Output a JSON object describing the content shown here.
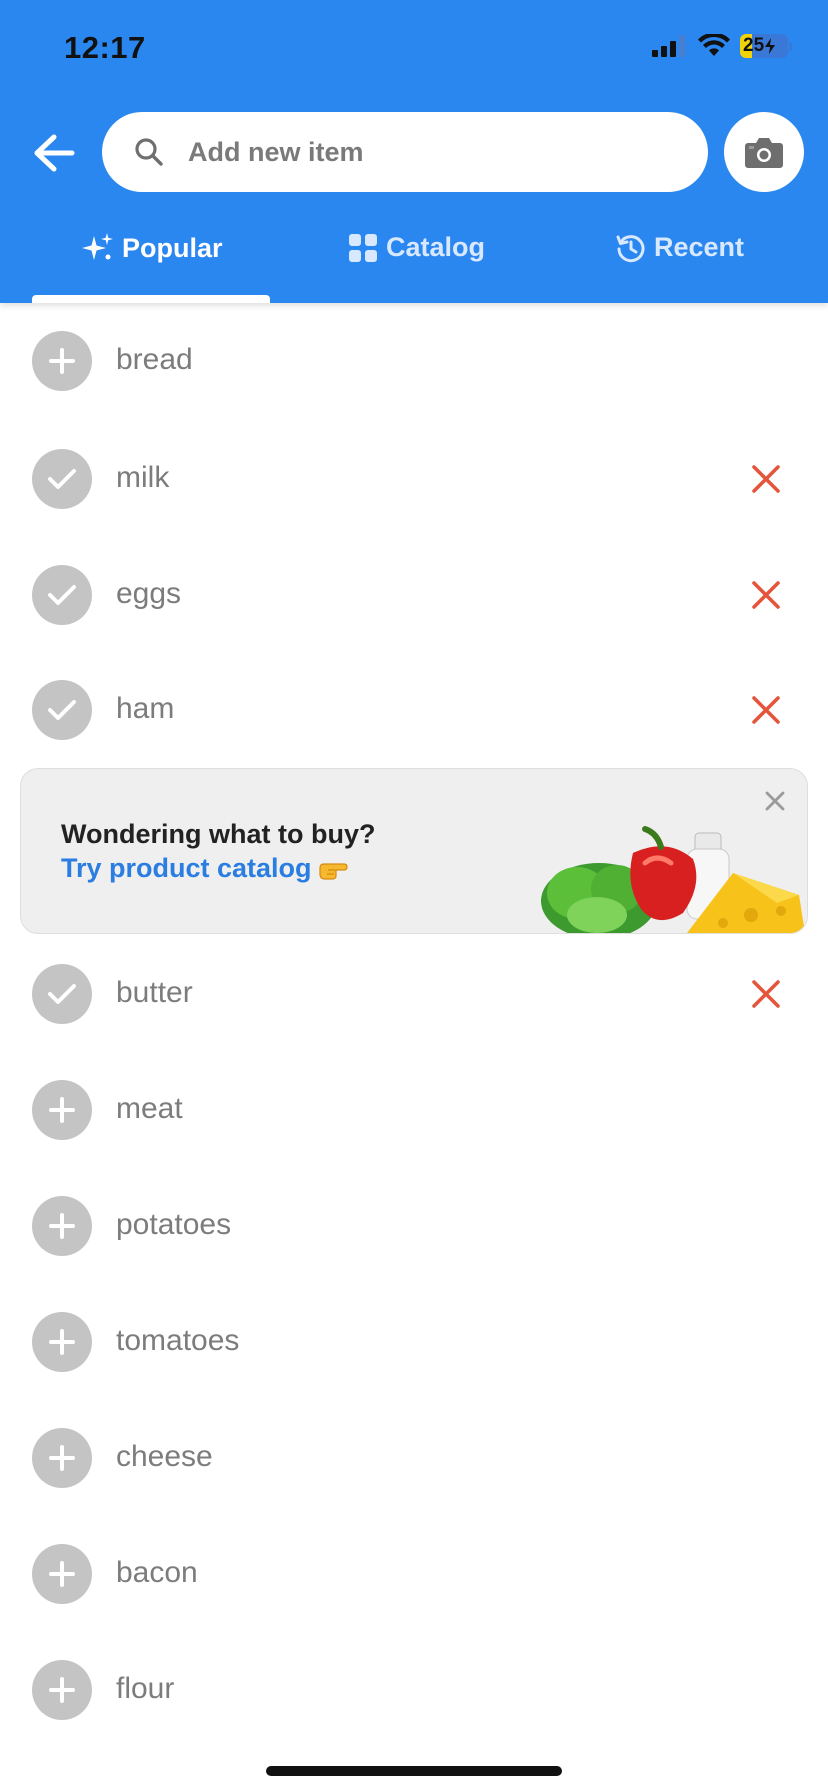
{
  "status_bar": {
    "time": "12:17",
    "battery": "25"
  },
  "search": {
    "placeholder": "Add new item"
  },
  "tabs": [
    {
      "label": "Popular",
      "active": true
    },
    {
      "label": "Catalog",
      "active": false
    },
    {
      "label": "Recent",
      "active": false
    }
  ],
  "items_top": [
    {
      "label": "bread",
      "state": "add"
    },
    {
      "label": "milk",
      "state": "added"
    },
    {
      "label": "eggs",
      "state": "added"
    },
    {
      "label": "ham",
      "state": "added"
    }
  ],
  "promo": {
    "title": "Wondering what to buy?",
    "link_text": "Try product catalog"
  },
  "items_bottom": [
    {
      "label": "butter",
      "state": "added"
    },
    {
      "label": "meat",
      "state": "add"
    },
    {
      "label": "potatoes",
      "state": "add"
    },
    {
      "label": "tomatoes",
      "state": "add"
    },
    {
      "label": "cheese",
      "state": "add"
    },
    {
      "label": "bacon",
      "state": "add"
    },
    {
      "label": "flour",
      "state": "add"
    }
  ],
  "colors": {
    "header": "#2b87f0",
    "remove": "#e5553b",
    "link": "#2a7de1",
    "circle": "#c4c4c4"
  }
}
